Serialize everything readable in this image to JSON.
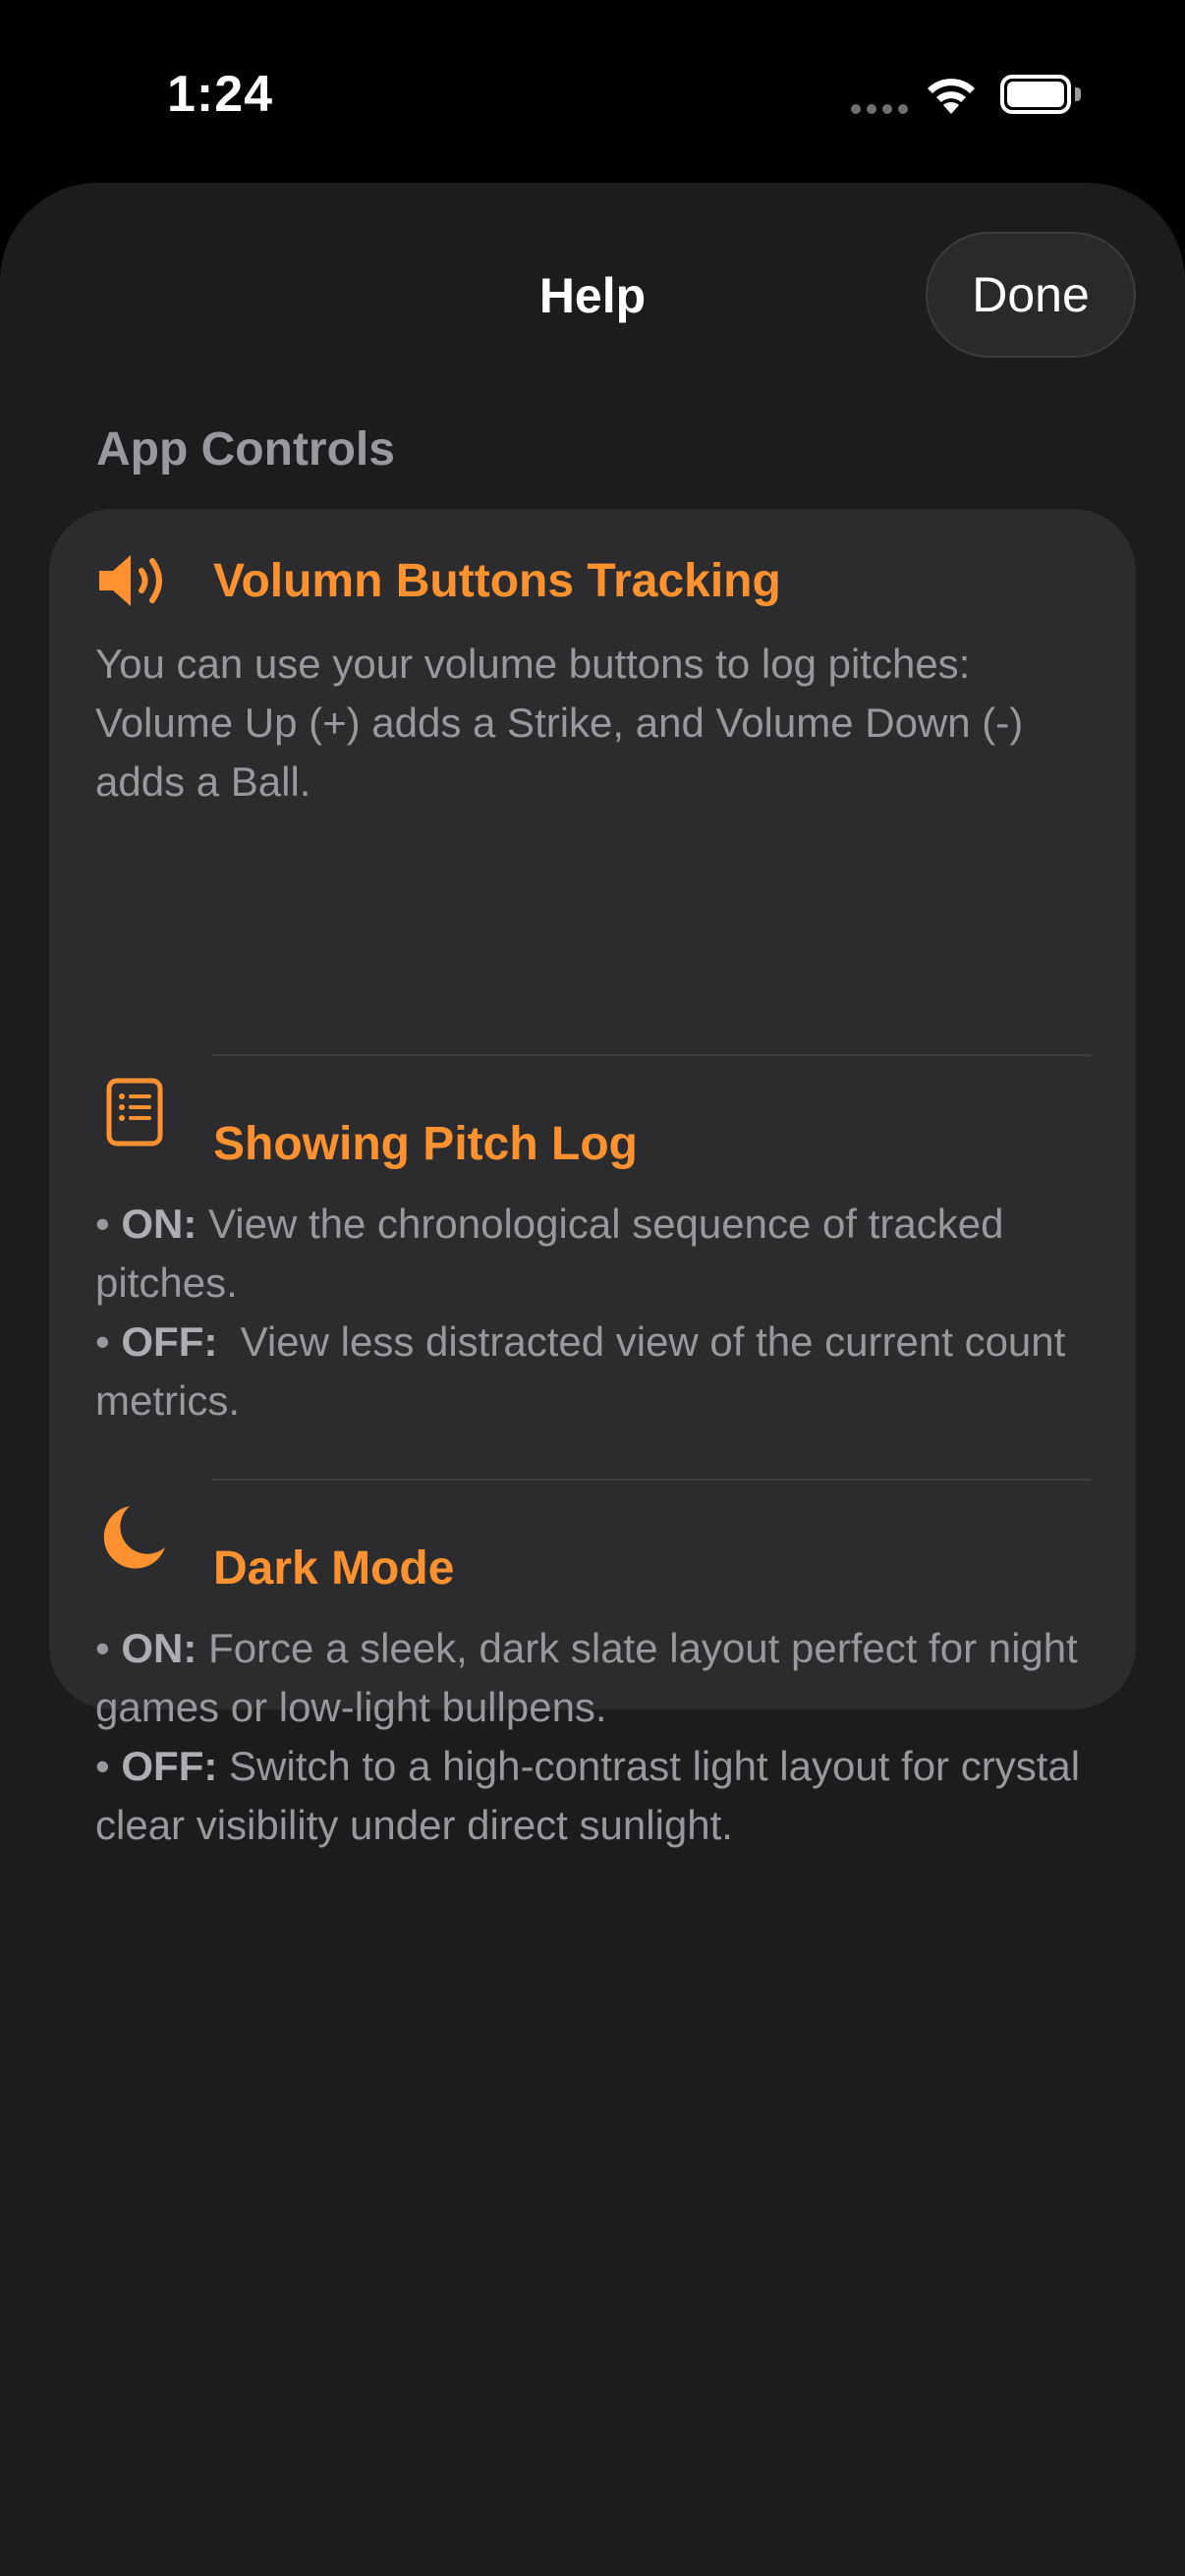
{
  "status_bar": {
    "time": "1:24"
  },
  "sheet": {
    "title": "Help",
    "done_label": "Done",
    "section_header": "App Controls"
  },
  "rows": [
    {
      "icon": "speaker-wave-icon",
      "title": "Volumn Buttons Tracking",
      "body": "You can use your volume buttons to log pitches: Volume Up (+) adds a Strike, and Volume Down (-) adds a Ball."
    },
    {
      "icon": "list-document-icon",
      "title": "Showing Pitch Log",
      "bullets": [
        {
          "prefix": "• ",
          "key": "ON:",
          "text": " View the chronological sequence of tracked pitches."
        },
        {
          "prefix": "• ",
          "key": "OFF:",
          "text": "  View less distracted view of the current count metrics."
        }
      ]
    },
    {
      "icon": "moon-icon",
      "title": "Dark Mode",
      "bullets": [
        {
          "prefix": "• ",
          "key": "ON:",
          "text": " Force a sleek, dark slate layout perfect for night games or low-light bullpens."
        },
        {
          "prefix": "• ",
          "key": "OFF:",
          "text": " Switch to a high-contrast light layout for crystal clear visibility under direct sunlight."
        }
      ]
    }
  ],
  "colors": {
    "accent": "#ff9230",
    "sheet_background": "#1c1c1e",
    "card_background": "#2c2c2e",
    "secondary_text": "#98989d"
  }
}
